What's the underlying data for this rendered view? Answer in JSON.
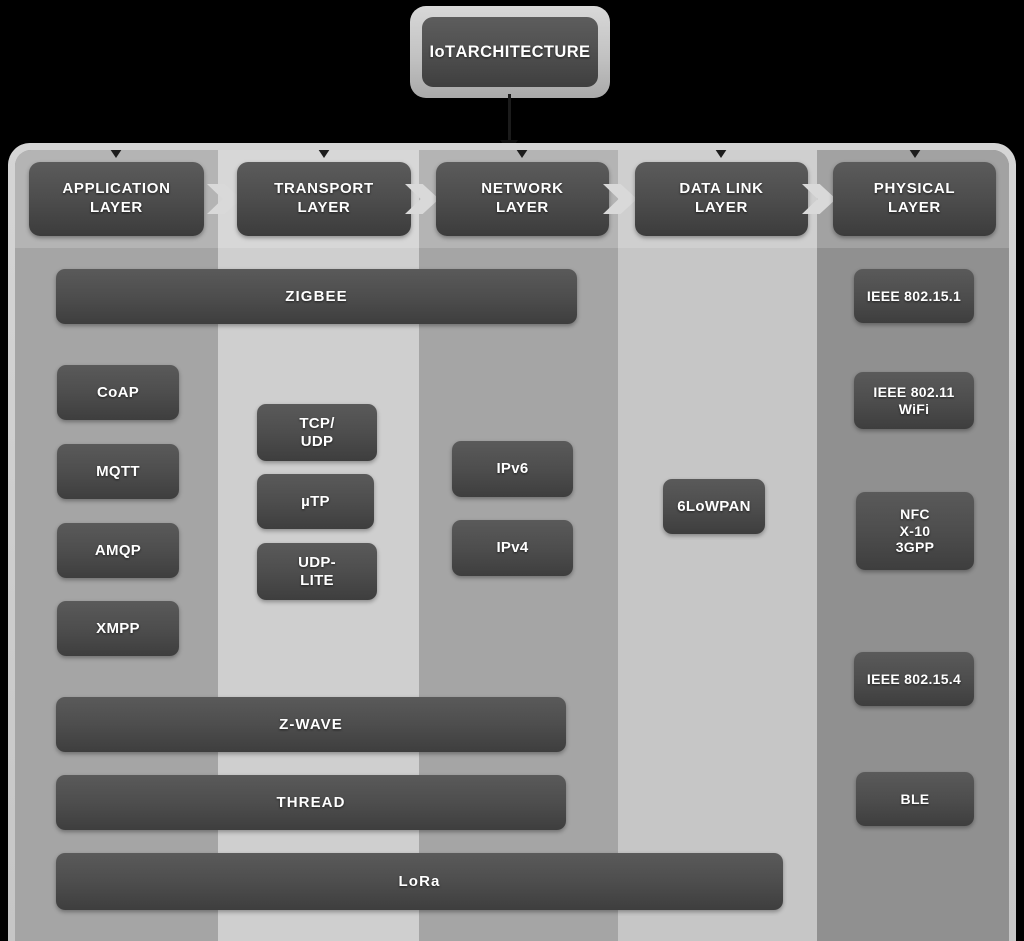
{
  "title": {
    "line1": "IoT",
    "line2": "ARCHITECTURE"
  },
  "colors": {
    "background": "#000000",
    "panel": "#a5a5a5",
    "panel_frame": "#c6c6c6",
    "band_light": "#cfcfcf",
    "band_lighter": "#e3e3e3",
    "box_dark": "#4d4d4d",
    "text": "#ffffff",
    "chevron": "#d9d9d9"
  },
  "layers": [
    {
      "id": "application",
      "label_line1": "APPLICATION",
      "label_line2": "LAYER"
    },
    {
      "id": "transport",
      "label_line1": "TRANSPORT",
      "label_line2": "LAYER"
    },
    {
      "id": "network",
      "label_line1": "NETWORK",
      "label_line2": "LAYER"
    },
    {
      "id": "datalink",
      "label_line1": "DATA LINK",
      "label_line2": "LAYER"
    },
    {
      "id": "physical",
      "label_line1": "PHYSICAL",
      "label_line2": "LAYER"
    }
  ],
  "protocols": {
    "spanning": [
      {
        "id": "zigbee",
        "label": "ZIGBEE"
      },
      {
        "id": "zwave",
        "label": "Z-WAVE"
      },
      {
        "id": "thread",
        "label": "THREAD"
      },
      {
        "id": "lora",
        "label": "LoRa"
      }
    ],
    "application": [
      {
        "id": "coap",
        "label": "CoAP"
      },
      {
        "id": "mqtt",
        "label": "MQTT"
      },
      {
        "id": "amqp",
        "label": "AMQP"
      },
      {
        "id": "xmpp",
        "label": "XMPP"
      }
    ],
    "transport": [
      {
        "id": "tcp-udp",
        "label_line1": "TCP/",
        "label_line2": "UDP"
      },
      {
        "id": "utp",
        "label_line1": "µTP",
        "label_line2": ""
      },
      {
        "id": "udp-lite",
        "label_line1": "UDP-",
        "label_line2": "LITE"
      }
    ],
    "network": [
      {
        "id": "ipv6",
        "label": "IPv6"
      },
      {
        "id": "ipv4",
        "label": "IPv4"
      }
    ],
    "datalink": [
      {
        "id": "6lowpan",
        "label": "6LoWPAN"
      }
    ],
    "physical": [
      {
        "id": "ieee-802-15-1",
        "label_line1": "IEEE 802.15.1",
        "label_line2": ""
      },
      {
        "id": "ieee-802-11",
        "label_line1": "IEEE 802.11",
        "label_line2": "WiFi"
      },
      {
        "id": "nfc-x10-3gpp",
        "label_line1": "NFC",
        "label_line2": "X-10",
        "label_line3": "3GPP"
      },
      {
        "id": "ieee-802-15-4",
        "label_line1": "IEEE 802.15.4",
        "label_line2": ""
      },
      {
        "id": "ble",
        "label_line1": "BLE",
        "label_line2": ""
      }
    ]
  }
}
